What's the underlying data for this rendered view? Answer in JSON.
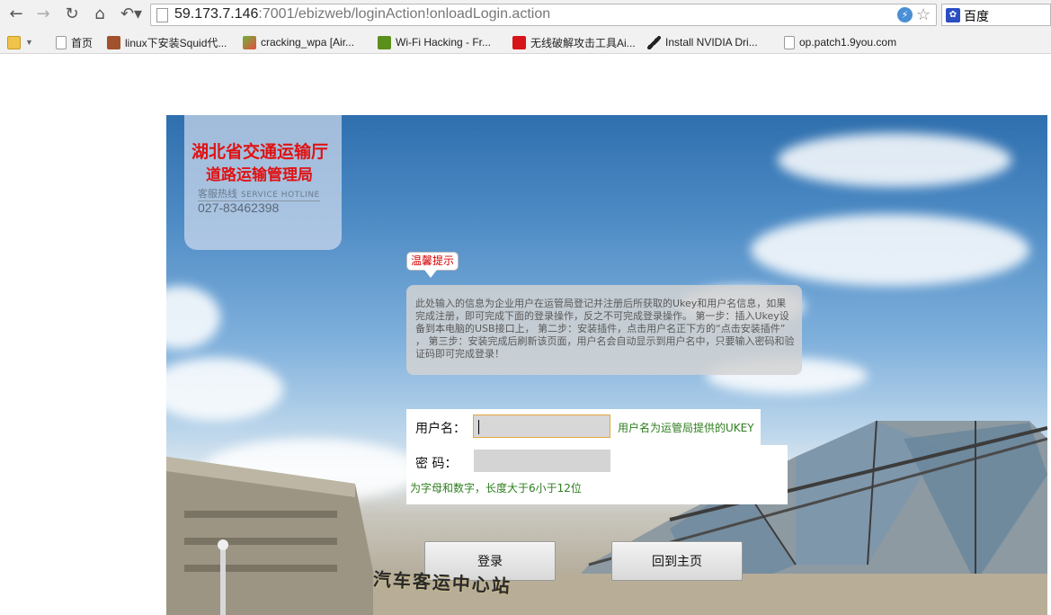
{
  "browser": {
    "url_host": "59.173.7.146",
    "url_rest": ":7001/ebizweb/loginAction!onloadLogin.action",
    "search_engine": "百度",
    "bookmarks": [
      {
        "label": "首页",
        "icon": "page-icon"
      },
      {
        "label": "linux下安装Squid代...",
        "icon": "b-logo-icon"
      },
      {
        "label": "cracking_wpa [Air...",
        "icon": "pencil-icon"
      },
      {
        "label": "Wi-Fi Hacking - Fr...",
        "icon": "f-logo-icon"
      },
      {
        "label": "无线破解攻击工具Ai...",
        "icon": "c-logo-icon"
      },
      {
        "label": "Install NVIDIA Dri...",
        "icon": "tools-icon"
      },
      {
        "label": "op.patch1.9you.com",
        "icon": "page-icon"
      }
    ]
  },
  "brand": {
    "line1": "湖北省交通运输厅",
    "line2": "道路运输管理局",
    "hotline_label": "客服热线",
    "hotline_label_en": "SERVICE HOTLINE",
    "hotline_number": "027-83462398"
  },
  "tip": {
    "title": "温馨提示",
    "body": "此处输入的信息为企业用户在运管局登记并注册后所获取的Ukey和用户名信息，如果完成注册，即可完成下面的登录操作，反之不可完成登录操作。 第一步：插入Ukey设备到本电脑的USB接口上，  第二步：安装插件，点击用户名正下方的“点击安装插件”  ，  第三步：安装完成后刷新该页面，用户名会自动显示到用户名中，只要输入密码和验证码即可完成登录！"
  },
  "form": {
    "username_label": "用户名：",
    "username_value": "",
    "username_hint": "用户名为运管局提供的UKEY",
    "password_label": "密  码：",
    "password_value": "",
    "password_hint": "为字母和数字，长度大于6小于12位"
  },
  "buttons": {
    "login": "登录",
    "home": "回到主页"
  },
  "scene": {
    "station_sign": "汽车客运中心站"
  },
  "colors": {
    "brand_red": "#e01212",
    "hint_green": "#2e7d1e",
    "tip_red": "#d60000"
  }
}
